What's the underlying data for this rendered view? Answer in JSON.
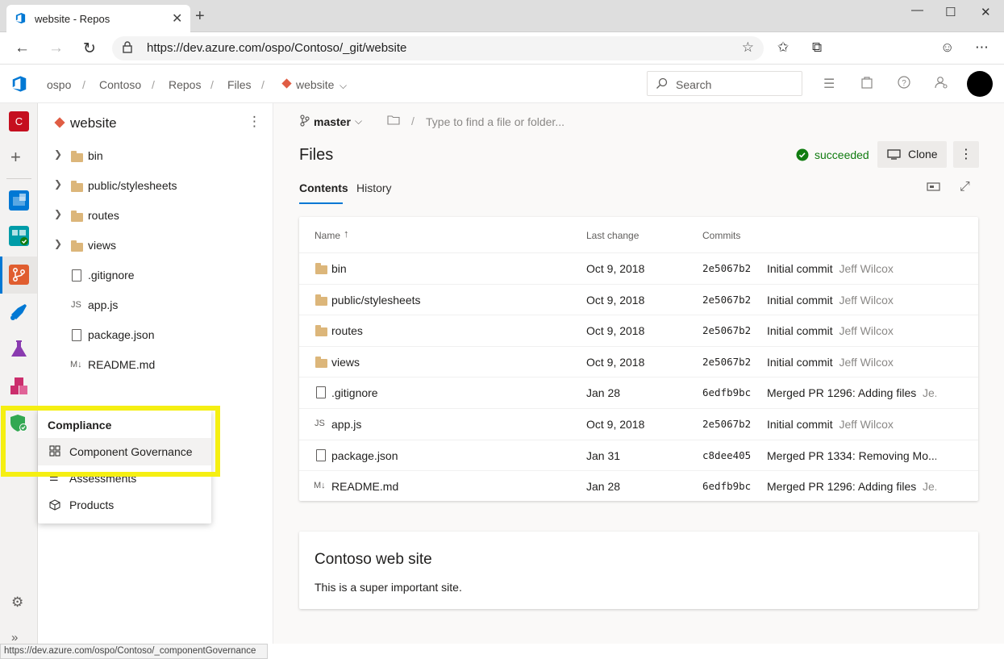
{
  "browser": {
    "tab_title": "website - Repos",
    "url": "https://dev.azure.com/ospo/Contoso/_git/website",
    "status_url": "https://dev.azure.com/ospo/Contoso/_componentGovernance"
  },
  "header": {
    "breadcrumbs": [
      "ospo",
      "Contoso",
      "Repos",
      "Files",
      "website"
    ],
    "search_placeholder": "Search"
  },
  "rail": {
    "org_initial": "C"
  },
  "tree": {
    "repo_name": "website",
    "items": [
      {
        "label": "bin",
        "type": "folder"
      },
      {
        "label": "public/stylesheets",
        "type": "folder"
      },
      {
        "label": "routes",
        "type": "folder"
      },
      {
        "label": "views",
        "type": "folder"
      },
      {
        "label": ".gitignore",
        "type": "file"
      },
      {
        "label": "app.js",
        "type": "js"
      },
      {
        "label": "package.json",
        "type": "file"
      },
      {
        "label": "README.md",
        "type": "md"
      }
    ]
  },
  "flyout": {
    "title": "Compliance",
    "items": [
      "Component Governance",
      "Assessments",
      "Products"
    ]
  },
  "main": {
    "branch": "master",
    "path_placeholder": "Type to find a file or folder...",
    "title": "Files",
    "status": "succeeded",
    "clone_label": "Clone",
    "tabs": [
      "Contents",
      "History"
    ],
    "columns": {
      "name": "Name",
      "last_change": "Last change",
      "commits": "Commits"
    },
    "rows": [
      {
        "name": "bin",
        "type": "folder",
        "date": "Oct 9, 2018",
        "hash": "2e5067b2",
        "message": "Initial commit",
        "author": "Jeff Wilcox"
      },
      {
        "name": "public/stylesheets",
        "type": "folder",
        "date": "Oct 9, 2018",
        "hash": "2e5067b2",
        "message": "Initial commit",
        "author": "Jeff Wilcox"
      },
      {
        "name": "routes",
        "type": "folder",
        "date": "Oct 9, 2018",
        "hash": "2e5067b2",
        "message": "Initial commit",
        "author": "Jeff Wilcox"
      },
      {
        "name": "views",
        "type": "folder",
        "date": "Oct 9, 2018",
        "hash": "2e5067b2",
        "message": "Initial commit",
        "author": "Jeff Wilcox"
      },
      {
        "name": ".gitignore",
        "type": "file",
        "date": "Jan 28",
        "hash": "6edfb9bc",
        "message": "Merged PR 1296: Adding files",
        "author": "Je..."
      },
      {
        "name": "app.js",
        "type": "js",
        "date": "Oct 9, 2018",
        "hash": "2e5067b2",
        "message": "Initial commit",
        "author": "Jeff Wilcox"
      },
      {
        "name": "package.json",
        "type": "file",
        "date": "Jan 31",
        "hash": "c8dee405",
        "message": "Merged PR 1334: Removing Mo...",
        "author": ""
      },
      {
        "name": "README.md",
        "type": "md",
        "date": "Jan 28",
        "hash": "6edfb9bc",
        "message": "Merged PR 1296: Adding files",
        "author": "Je..."
      }
    ],
    "readme_title": "Contoso web site",
    "readme_body": "This is a super important site."
  },
  "colors": {
    "accent": "#0078d4",
    "success": "#107c10",
    "highlight": "#f5ef12",
    "folder": "#dcb67a"
  }
}
